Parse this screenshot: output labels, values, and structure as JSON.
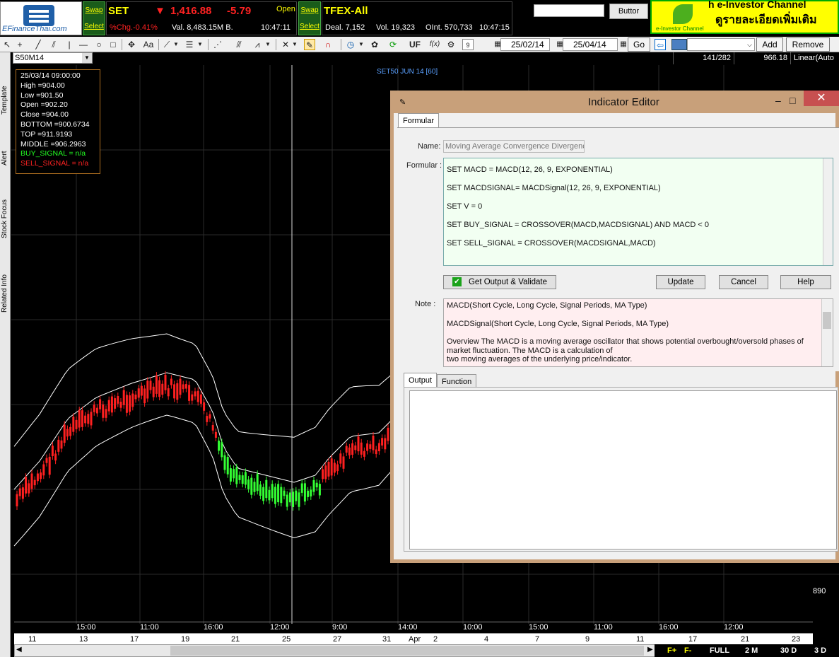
{
  "top": {
    "logo_text": "EFinanceThai.com",
    "swap_label": "Swap",
    "select_label": "Select",
    "set": {
      "name": "SET",
      "arrow": "▼",
      "index": "1,416.88",
      "change": "-5.79",
      "status": "Open",
      "pct_change": "%Chg.-0.41%",
      "value": "Val. 8,483.15M B.",
      "time": "10:47:11"
    },
    "tfex": {
      "name": "TFEX-All",
      "deal": "Deal. 7,152",
      "vol": "Vol. 19,323",
      "oint": "OInt. 570,733",
      "time": "10:47:15"
    },
    "button_label": "Buttor",
    "banner": {
      "line1": "ĥ e-Investor Channel",
      "line2": "ดูรายละเอียดเพิ่มเติม",
      "small": "e-Investor Channel"
    }
  },
  "toolbar": {
    "date_from": "25/02/14",
    "date_to": "25/04/14",
    "go_label": "Go",
    "add_label": "Add",
    "remove_label": "Remove",
    "uf_label": "UF",
    "fx_label": "f(x)",
    "aa_label": "Aa",
    "cal_label": "9"
  },
  "status": {
    "symbol": "S50M14",
    "count": "141/282",
    "price": "966.18",
    "scale": "Linear(Auto"
  },
  "sidebar_tabs": [
    "Template",
    "Alert",
    "Stock Focus",
    "Related Info"
  ],
  "chart": {
    "label": "SET50 JUN 14",
    "interval": "[60]",
    "price_tick": "890",
    "info": {
      "datetime": "25/03/14 09:00:00",
      "high": "High =904.00",
      "low": "Low =901.50",
      "open": "Open =902.20",
      "close": "Close =904.00",
      "bottom": "BOTTOM =900.6734",
      "top": "TOP =911.9193",
      "middle": "MIDDLE =906.2963",
      "buy": "BUY_SIGNAL = n/a",
      "sell": "SELL_SIGNAL = n/a"
    },
    "time_ticks": [
      "15:00",
      "11:00",
      "16:00",
      "12:00",
      "9:00",
      "14:00",
      "10:00",
      "15:00",
      "11:00",
      "16:00",
      "12:00"
    ],
    "date_ticks": [
      "11",
      "13",
      "17",
      "19",
      "21",
      "25",
      "27",
      "31",
      "Apr",
      "2",
      "4",
      "7",
      "9",
      "11",
      "17",
      "21",
      "23"
    ],
    "periods": [
      "F+",
      "F-",
      "FULL",
      "2 M",
      "30 D",
      "3 D"
    ],
    "colors": {
      "up": "#33ff33",
      "down": "#ff2020",
      "band": "#ffffff",
      "grid": "#2a2a2a"
    }
  },
  "dialog": {
    "title": "Indicator Editor",
    "tab": "Formular",
    "name_label": "Name:",
    "name_value": "Moving Average Convergence Divergenc",
    "formula_label": "Formular :",
    "formula_lines": [
      "SET MACD = MACD(12, 26, 9, EXPONENTIAL)",
      "SET MACDSIGNAL= MACDSignal(12, 26, 9,  EXPONENTIAL)",
      "SET V = 0",
      "SET BUY_SIGNAL = CROSSOVER(MACD,MACDSIGNAL)  AND MACD < 0",
      "SET SELL_SIGNAL = CROSSOVER(MACDSIGNAL,MACD)"
    ],
    "validate_label": "Get Output & Validate",
    "update_label": "Update",
    "cancel_label": "Cancel",
    "help_label": "Help",
    "note_label": "Note :",
    "note_lines": [
      "MACD(Short Cycle, Long Cycle, Signal Periods, MA Type)",
      "MACDSignal(Short Cycle, Long Cycle, Signal Periods, MA Type)",
      " Overview The MACD is a moving average oscillator that shows potential overbought/oversold phases of market fluctuation. The MACD is a calculation of",
      "two moving averages of the underlying price/indicator."
    ],
    "output_tab": "Output",
    "function_tab": "Function"
  }
}
